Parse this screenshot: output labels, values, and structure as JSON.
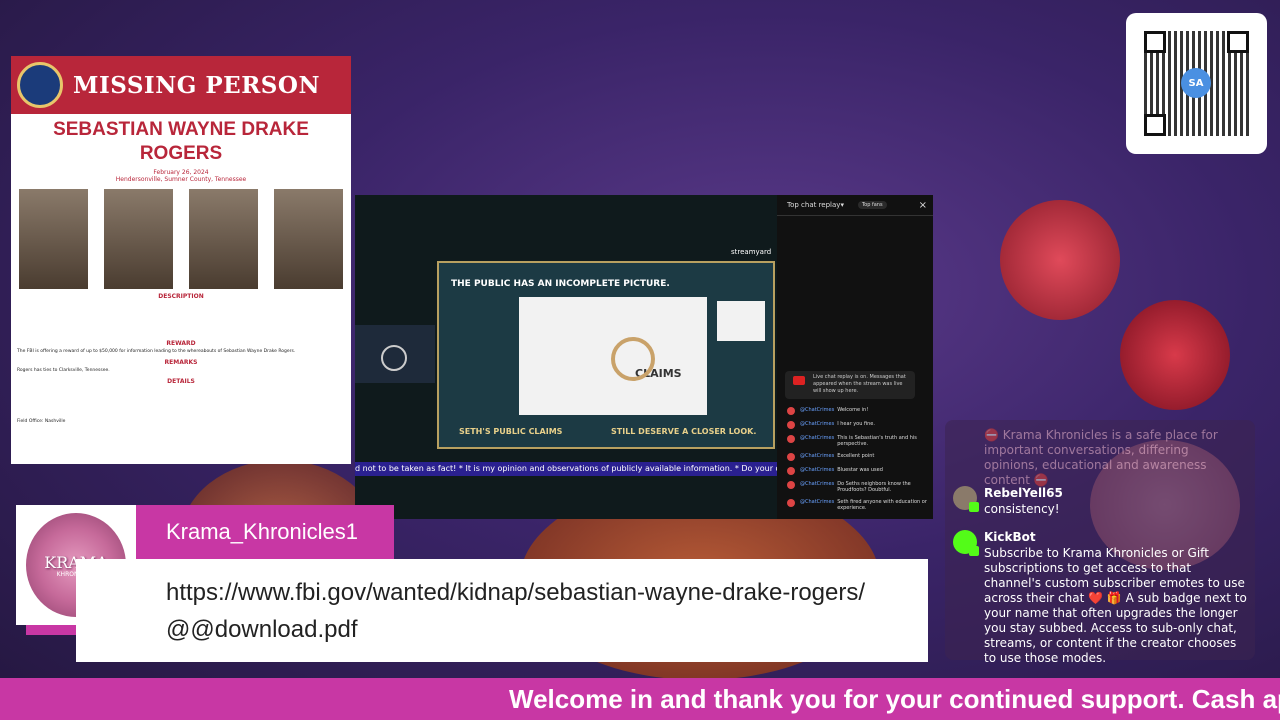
{
  "poster": {
    "header": "MISSING PERSON",
    "name": "SEBASTIAN WAYNE DRAKE ROGERS",
    "date": "February 26, 2024",
    "place": "Hendersonville, Sumner County, Tennessee",
    "description_title": "DESCRIPTION",
    "reward_title": "REWARD",
    "reward_text": "The FBI is offering a reward of up to $50,000 for information leading to the whereabouts of Sebastian Wayne Drake Rogers.",
    "remarks_title": "REMARKS",
    "remarks_text": "Rogers has ties to Clarksville, Tennessee.",
    "details_title": "DETAILS",
    "field_office": "Field Office: Nashville"
  },
  "video": {
    "slide_title": "THE PUBLIC HAS AN INCOMPLETE PICTURE.",
    "claims": "CLAIMS",
    "left_caption": "SETH'S PUBLIC CLAIMS",
    "right_caption": "STILL DESERVE A CLOSER LOOK.",
    "watermark": "streamyard",
    "ticker": "d not to be taken as fact! * It is my opinion and observations of publicly available information. * Do your own"
  },
  "replay": {
    "title": "Top chat replay",
    "badge": "Top fans",
    "note": "Live chat replay is on. Messages that appeared when the stream was live will show up here.",
    "messages": [
      {
        "user": "@ChatCrimes",
        "text": "Welcome in!"
      },
      {
        "user": "@ChatCrimes",
        "text": "I hear you fine."
      },
      {
        "user": "@ChatCrimes",
        "text": "This is Sebastian's truth and his perspective."
      },
      {
        "user": "@ChatCrimes",
        "text": "Excellent point"
      },
      {
        "user": "@ChatCrimes",
        "text": "Bluestar was used"
      },
      {
        "user": "@ChatCrimes",
        "text": "Do Seths neighbors know the Proudfoots? Doubtful."
      },
      {
        "user": "@ChatCrimes",
        "text": "Seth fired anyone with education or experience."
      }
    ]
  },
  "streamer": {
    "name": "Krama_Khronicles1",
    "logo_text": "KRAMA",
    "logo_sub": "KHRONICLES",
    "kick_glyph": "K",
    "message": "https://www.fbi.gov/wanted/kidnap/sebastian-wayne-drake-rogers/@@download.pdf"
  },
  "qr": {
    "logo_text": "SA"
  },
  "chat": {
    "system": "⛔ Krama Khronicles is a safe place for important conversations, differing opinions, educational and awareness content ⛔",
    "messages": [
      {
        "user": "RebelYell65",
        "text": "consistency!"
      },
      {
        "user": "KickBot",
        "text": "Subscribe to Krama Khronicles or Gift subscriptions to get access to that channel's custom subscriber emotes to use across their chat ❤️ 🎁 A sub badge next to your name that often upgrades the longer you stay subbed. Access to sub-only chat, streams, or content if the creator chooses to use those modes."
      }
    ]
  },
  "ticker": {
    "text": "Welcome in and thank you for your continued support. Cash app"
  },
  "colors": {
    "brand_pink": "#c837a4",
    "kick_green": "#53fc18",
    "fbi_red": "#b8263a"
  }
}
